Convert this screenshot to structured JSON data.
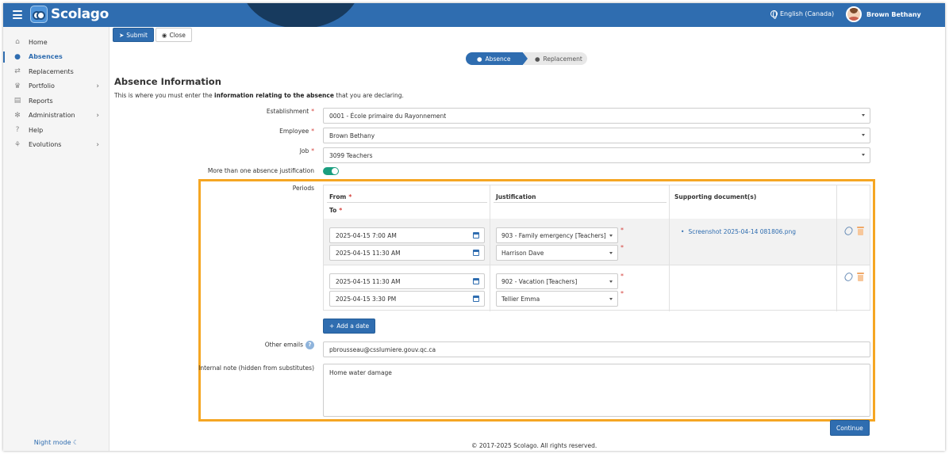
{
  "header": {
    "brand": "Scolago",
    "language": "English (Canada)",
    "user_name": "Brown Bethany"
  },
  "sidebar": {
    "items": [
      {
        "label": "Home",
        "icon": "home-icon",
        "has_submenu": false
      },
      {
        "label": "Absences",
        "icon": "absence-user-icon",
        "has_submenu": false,
        "active": true
      },
      {
        "label": "Replacements",
        "icon": "replacement-icon",
        "has_submenu": false
      },
      {
        "label": "Portfolio",
        "icon": "trophy-icon",
        "has_submenu": true
      },
      {
        "label": "Reports",
        "icon": "report-icon",
        "has_submenu": false
      },
      {
        "label": "Administration",
        "icon": "gear-icon",
        "has_submenu": true
      },
      {
        "label": "Help",
        "icon": "question-icon",
        "has_submenu": false
      },
      {
        "label": "Evolutions",
        "icon": "sprout-icon",
        "has_submenu": true
      }
    ],
    "night_mode": "Night mode"
  },
  "toolbar": {
    "submit_label": "Submit",
    "close_label": "Close"
  },
  "steps": {
    "step1": "Absence",
    "step2": "Replacement"
  },
  "form": {
    "title": "Absence Information",
    "desc_pre": "This is where you must enter the ",
    "desc_bold": "information relating to the absence",
    "desc_post": " that you are declaring.",
    "establishment_label": "Establishment",
    "establishment_value": "0001 - École primaire du Rayonnement",
    "employee_label": "Employee",
    "employee_value": "Brown Bethany",
    "job_label": "Job",
    "job_value": "3099 Teachers",
    "multi_label": "More than one absence justification",
    "periods_label": "Periods",
    "other_emails_label": "Other emails",
    "other_emails_value": "pbrousseau@csslumiere.gouv.qc.ca",
    "note_label": "Internal note (hidden from substitutes)",
    "note_value": "Home water damage",
    "required_mark": "*",
    "help_mark": "?"
  },
  "periods": {
    "headers": {
      "from": "From",
      "to": "To",
      "justification": "Justification",
      "documents": "Supporting document(s)"
    },
    "rows": [
      {
        "from": "2025-04-15 7:00 AM",
        "to": "2025-04-15 11:30 AM",
        "justification": "903 - Family emergency [Teachers]",
        "approver": "Harrison Dave",
        "document": "Screenshot 2025-04-14 081806.png"
      },
      {
        "from": "2025-04-15 11:30 AM",
        "to": "2025-04-15 3:30 PM",
        "justification": "902 - Vacation [Teachers]",
        "approver": "Tellier Emma",
        "document": ""
      }
    ],
    "add_label": "Add a date"
  },
  "actions": {
    "continue_label": "Continue"
  },
  "footer": {
    "copyright": "© 2017-2025 Scolago. All rights reserved."
  },
  "colors": {
    "primary": "#2f6db0",
    "highlight": "#f5a623",
    "toggle_on": "#1a9e7f",
    "required": "#d43f3a"
  }
}
